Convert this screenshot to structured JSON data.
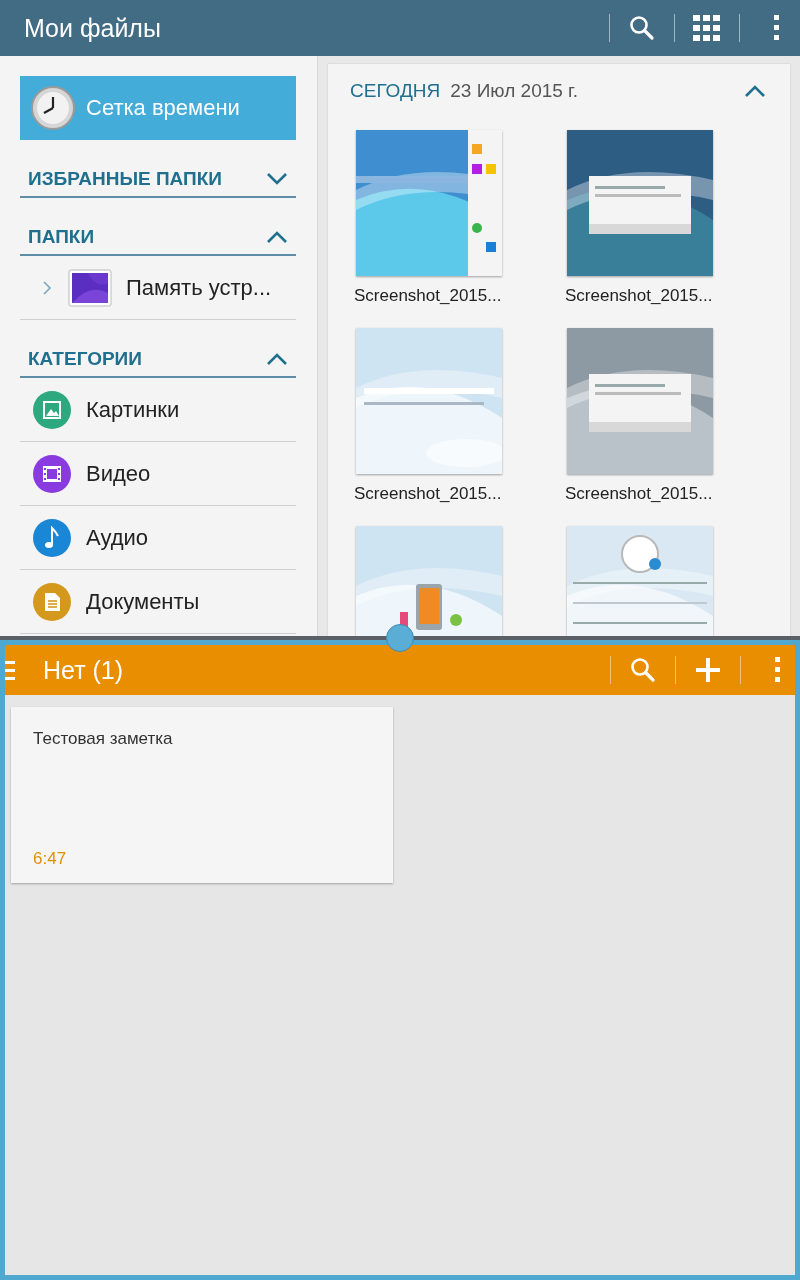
{
  "files_app": {
    "title": "Мои файлы",
    "timeline_button": {
      "label": "Сетка времени",
      "selected": true
    },
    "sections": [
      {
        "title": "ИЗБРАННЫЕ ПАПКИ",
        "expanded": false
      },
      {
        "title": "ПАПКИ",
        "expanded": true,
        "items": [
          {
            "kind": "folder",
            "label": "Память устр..."
          }
        ]
      },
      {
        "title": "КАТЕГОРИИ",
        "expanded": true,
        "items": [
          {
            "kind": "images",
            "label": "Картинки",
            "color": "#2ea87e"
          },
          {
            "kind": "video",
            "label": "Видео",
            "color": "#8a3be0"
          },
          {
            "kind": "audio",
            "label": "Аудио",
            "color": "#1a86d6"
          },
          {
            "kind": "documents",
            "label": "Документы",
            "color": "#d4991c"
          }
        ]
      }
    ],
    "group": {
      "title": "СЕГОДНЯ",
      "date": "23 Июл 2015 г.",
      "expanded": true,
      "files": [
        {
          "kind": "picture",
          "name": "Screenshot_2015..."
        },
        {
          "kind": "picture",
          "name": "Screenshot_2015..."
        },
        {
          "kind": "picture",
          "name": "Screenshot_2015..."
        },
        {
          "kind": "picture",
          "name": "Screenshot_2015..."
        },
        {
          "kind": "picture"
        },
        {
          "kind": "picture"
        }
      ]
    }
  },
  "memo_app": {
    "title": "Нет (1)",
    "notes": [
      {
        "title": "Тестовая заметка",
        "time": "6:47"
      }
    ]
  }
}
